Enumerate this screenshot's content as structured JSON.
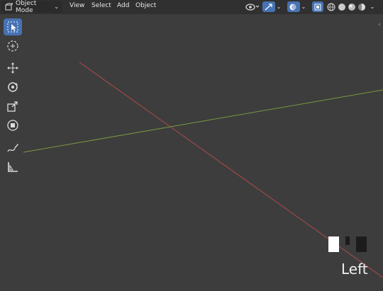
{
  "header": {
    "mode_label": "Object Mode",
    "menus": [
      "View",
      "Select",
      "Add",
      "Object"
    ]
  },
  "viewport": {
    "view_name": "Left"
  },
  "toolbar": {
    "tools": [
      {
        "name": "select-box-tool",
        "icon": "select-box-icon",
        "active": true
      },
      {
        "name": "cursor-tool",
        "icon": "cursor-icon",
        "active": false
      },
      {
        "name": "move-tool",
        "icon": "move-icon",
        "active": false
      },
      {
        "name": "rotate-tool",
        "icon": "rotate-icon",
        "active": false
      },
      {
        "name": "scale-tool",
        "icon": "scale-icon",
        "active": false
      },
      {
        "name": "transform-tool",
        "icon": "transform-icon",
        "active": false
      },
      {
        "name": "annotate-tool",
        "icon": "annotate-icon",
        "active": false
      },
      {
        "name": "measure-tool",
        "icon": "measure-icon",
        "active": false
      }
    ]
  },
  "colors": {
    "accent": "#4772b3",
    "x_axis": "#c04a4a",
    "y_axis": "#7c9a3b",
    "background": "#3d3d3d"
  }
}
